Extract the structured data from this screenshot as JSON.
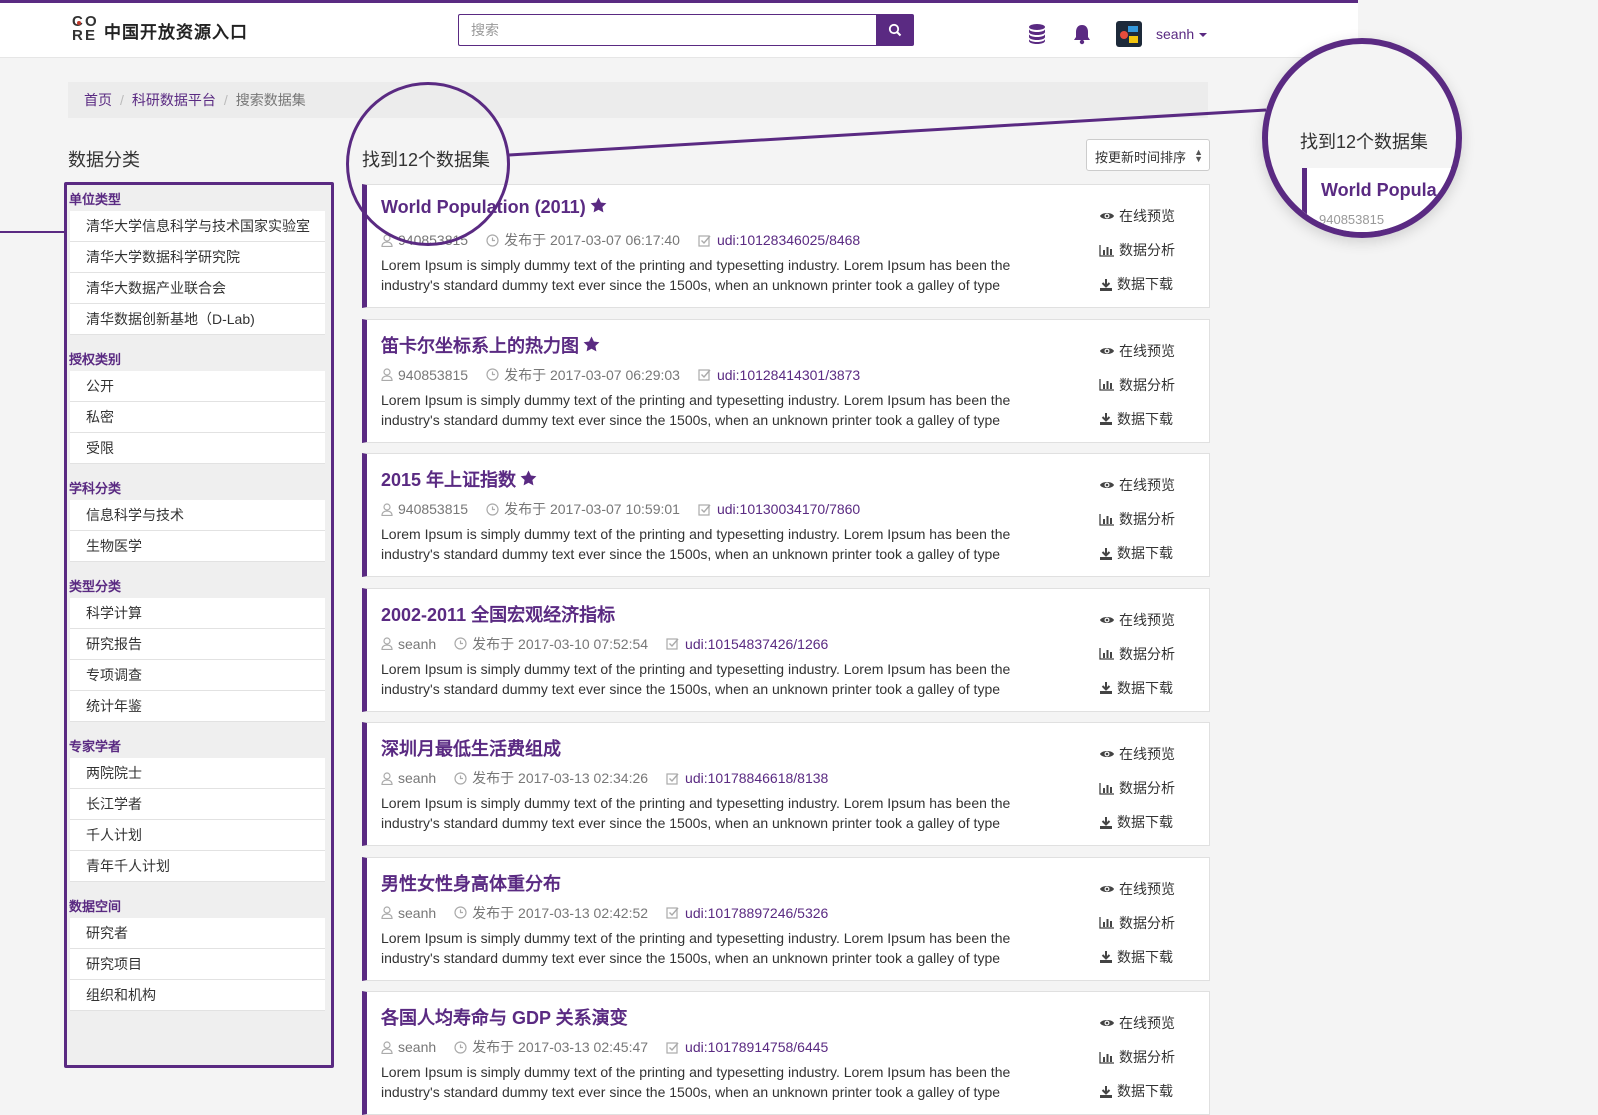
{
  "header": {
    "logo_text": "中国开放资源入口",
    "search_placeholder": "搜索",
    "username": "seanh"
  },
  "breadcrumb": {
    "home": "首页",
    "platform": "科研数据平台",
    "current": "搜索数据集"
  },
  "sidebar": {
    "title": "数据分类",
    "groups": [
      {
        "name": "单位类型",
        "items": [
          "清华大学信息科学与技术国家实验室",
          "清华大学数据科学研究院",
          "清华大数据产业联合会",
          "清华数据创新基地（D-Lab)"
        ]
      },
      {
        "name": "授权类别",
        "items": [
          "公开",
          "私密",
          "受限"
        ]
      },
      {
        "name": "学科分类",
        "items": [
          "信息科学与技术",
          "生物医学"
        ]
      },
      {
        "name": "类型分类",
        "items": [
          "科学计算",
          "研究报告",
          "专项调查",
          "统计年鉴"
        ]
      },
      {
        "name": "专家学者",
        "items": [
          "两院院士",
          "长江学者",
          "千人计划",
          "青年千人计划"
        ]
      },
      {
        "name": "数据空间",
        "items": [
          "研究者",
          "研究项目",
          "组织和机构"
        ]
      }
    ]
  },
  "results": {
    "count_text": "找到12个数据集",
    "sort_label": "按更新时间排序",
    "actions": {
      "preview": "在线预览",
      "analysis": "数据分析",
      "download": "数据下载"
    },
    "description": "Lorem Ipsum is simply dummy text of the printing and typesetting industry. Lorem Ipsum has been the industry's standard dummy text ever since the 1500s, when an unknown printer took a galley of type",
    "items": [
      {
        "title": "World Population (2011)",
        "starred": true,
        "user": "940853815",
        "date": "发布于 2017-03-07 06:17:40",
        "udi": "udi:10128346025/8468"
      },
      {
        "title": "笛卡尔坐标系上的热力图",
        "starred": true,
        "user": "940853815",
        "date": "发布于 2017-03-07 06:29:03",
        "udi": "udi:10128414301/3873"
      },
      {
        "title": "2015 年上证指数",
        "starred": true,
        "user": "940853815",
        "date": "发布于 2017-03-07 10:59:01",
        "udi": "udi:10130034170/7860"
      },
      {
        "title": "2002-2011 全国宏观经济指标",
        "starred": false,
        "user": "seanh",
        "date": "发布于 2017-03-10 07:52:54",
        "udi": "udi:10154837426/1266"
      },
      {
        "title": "深圳月最低生活费组成",
        "starred": false,
        "user": "seanh",
        "date": "发布于 2017-03-13 02:34:26",
        "udi": "udi:10178846618/8138"
      },
      {
        "title": "男性女性身高体重分布",
        "starred": false,
        "user": "seanh",
        "date": "发布于 2017-03-13 02:42:52",
        "udi": "udi:10178897246/5326"
      },
      {
        "title": "各国人均寿命与 GDP 关系演变",
        "starred": false,
        "user": "seanh",
        "date": "发布于 2017-03-13 02:45:47",
        "udi": "udi:10178914758/6445"
      }
    ]
  },
  "zoom": {
    "count_text": "找到12个数据集",
    "card_title": "World Popula",
    "card_user": "940853815"
  },
  "colors": {
    "accent": "#5a2a82"
  }
}
